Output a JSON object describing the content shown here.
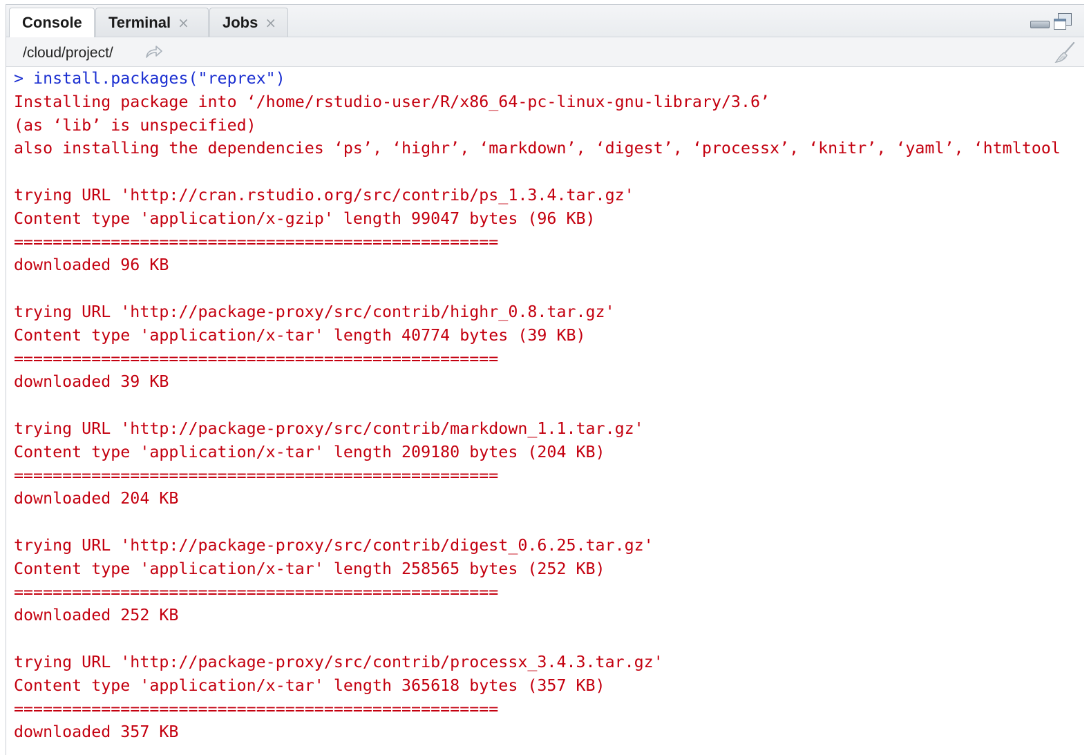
{
  "tabs": [
    {
      "label": "Console",
      "closable": false
    },
    {
      "label": "Terminal",
      "closable": true
    },
    {
      "label": "Jobs",
      "closable": true
    }
  ],
  "close_glyph": "×",
  "path": "/cloud/project/",
  "icons": {
    "share": "share-arrow-icon",
    "clear": "broom-icon",
    "minimize": "minimize-icon",
    "maximize": "maximize-icon"
  },
  "colors": {
    "input": "#1b2fd1",
    "output": "#c4000f"
  },
  "console": {
    "lines": [
      {
        "type": "input",
        "text": "> install.packages(\"reprex\")"
      },
      {
        "type": "output",
        "text": "Installing package into ‘/home/rstudio-user/R/x86_64-pc-linux-gnu-library/3.6’"
      },
      {
        "type": "output",
        "text": "(as ‘lib’ is unspecified)"
      },
      {
        "type": "output",
        "text": "also installing the dependencies ‘ps’, ‘highr’, ‘markdown’, ‘digest’, ‘processx’, ‘knitr’, ‘yaml’, ‘htmltool"
      },
      {
        "type": "output",
        "text": ""
      },
      {
        "type": "output",
        "text": "trying URL 'http://cran.rstudio.org/src/contrib/ps_1.3.4.tar.gz'"
      },
      {
        "type": "output",
        "text": "Content type 'application/x-gzip' length 99047 bytes (96 KB)"
      },
      {
        "type": "output",
        "text": "=================================================="
      },
      {
        "type": "output",
        "text": "downloaded 96 KB"
      },
      {
        "type": "output",
        "text": ""
      },
      {
        "type": "output",
        "text": "trying URL 'http://package-proxy/src/contrib/highr_0.8.tar.gz'"
      },
      {
        "type": "output",
        "text": "Content type 'application/x-tar' length 40774 bytes (39 KB)"
      },
      {
        "type": "output",
        "text": "=================================================="
      },
      {
        "type": "output",
        "text": "downloaded 39 KB"
      },
      {
        "type": "output",
        "text": ""
      },
      {
        "type": "output",
        "text": "trying URL 'http://package-proxy/src/contrib/markdown_1.1.tar.gz'"
      },
      {
        "type": "output",
        "text": "Content type 'application/x-tar' length 209180 bytes (204 KB)"
      },
      {
        "type": "output",
        "text": "=================================================="
      },
      {
        "type": "output",
        "text": "downloaded 204 KB"
      },
      {
        "type": "output",
        "text": ""
      },
      {
        "type": "output",
        "text": "trying URL 'http://package-proxy/src/contrib/digest_0.6.25.tar.gz'"
      },
      {
        "type": "output",
        "text": "Content type 'application/x-tar' length 258565 bytes (252 KB)"
      },
      {
        "type": "output",
        "text": "=================================================="
      },
      {
        "type": "output",
        "text": "downloaded 252 KB"
      },
      {
        "type": "output",
        "text": ""
      },
      {
        "type": "output",
        "text": "trying URL 'http://package-proxy/src/contrib/processx_3.4.3.tar.gz'"
      },
      {
        "type": "output",
        "text": "Content type 'application/x-tar' length 365618 bytes (357 KB)"
      },
      {
        "type": "output",
        "text": "=================================================="
      },
      {
        "type": "output",
        "text": "downloaded 357 KB"
      }
    ]
  }
}
